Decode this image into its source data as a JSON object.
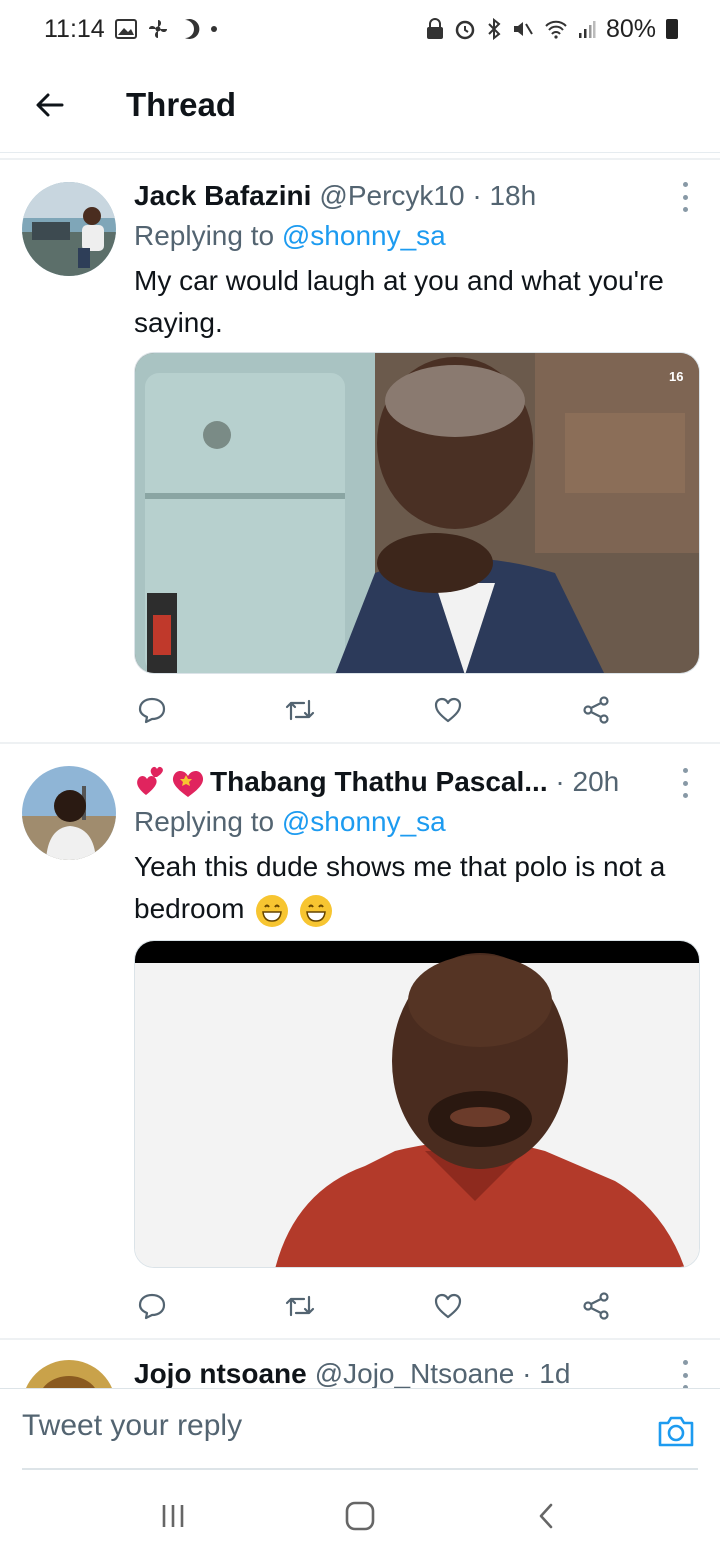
{
  "status_bar": {
    "time": "11:14",
    "battery": "80%"
  },
  "header": {
    "title": "Thread"
  },
  "tweets": [
    {
      "name": "Jack Bafazini",
      "handle": "@Percyk10",
      "time": "18h",
      "replying_label": "Replying to",
      "replying_to": "@shonny_sa",
      "text": "My car would laugh at you and what you're saying."
    },
    {
      "name": "Thabang Thathu Pascal...",
      "handle": "",
      "time": "20h",
      "replying_label": "Replying to",
      "replying_to": "@shonny_sa",
      "text": "Yeah this dude shows me that polo is not a bedroom"
    },
    {
      "name": "Jojo ntsoane",
      "handle": "@Jojo_Ntsoane",
      "time": "1d"
    }
  ],
  "composer": {
    "placeholder": "Tweet your reply"
  },
  "colors": {
    "accent": "#1d9bf0",
    "muted": "#536471",
    "text": "#0f1419"
  }
}
